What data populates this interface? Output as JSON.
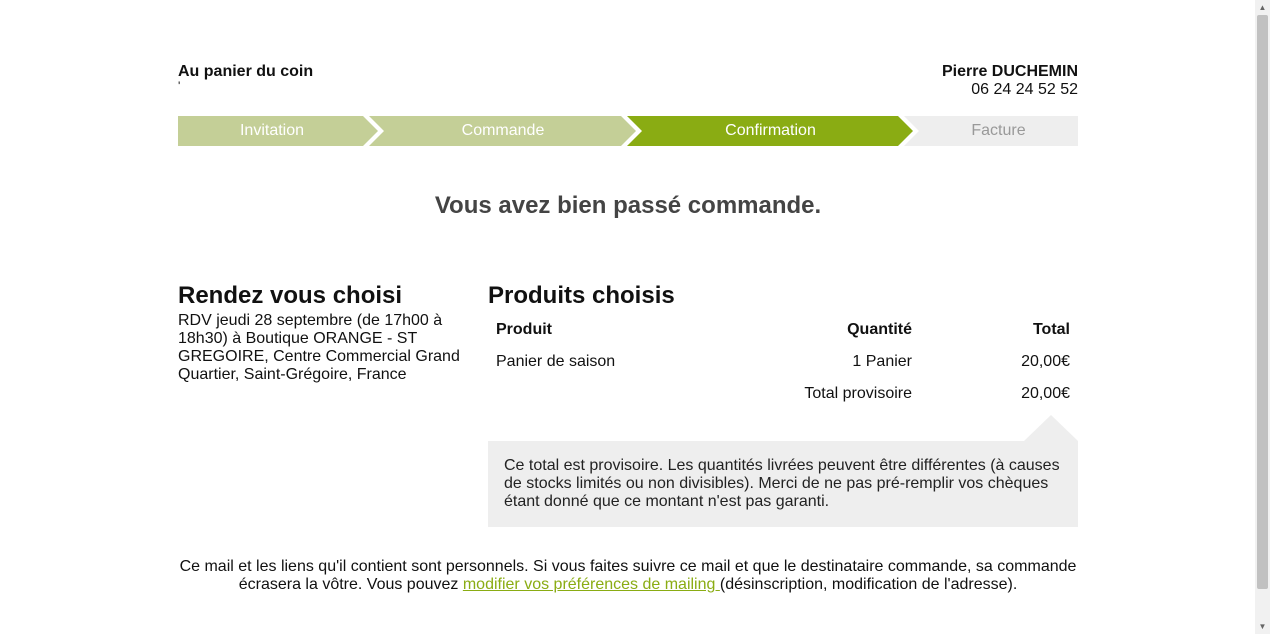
{
  "header": {
    "shop_name": "Au panier du coin",
    "shop_sub": "'",
    "user_name": "Pierre DUCHEMIN",
    "user_phone": "06 24 24 52 52"
  },
  "steps": [
    {
      "label": "Invitation",
      "state": "done"
    },
    {
      "label": "Commande",
      "state": "done"
    },
    {
      "label": "Confirmation",
      "state": "active"
    },
    {
      "label": "Facture",
      "state": "pending"
    }
  ],
  "colors": {
    "step_done": "#c4cf97",
    "step_active": "#8aac13",
    "step_pending": "#eeeeee",
    "link": "#8aac13"
  },
  "confirm_title": "Vous avez bien passé commande.",
  "rdv": {
    "heading": "Rendez vous choisi",
    "text": "RDV jeudi 28 septembre (de 17h00 à 18h30) à Boutique ORANGE - ST GREGOIRE, Centre Commercial Grand Quartier, Saint-Grégoire, France"
  },
  "products": {
    "heading": "Produits choisis",
    "columns": [
      "Produit",
      "Quantité",
      "Total"
    ],
    "rows": [
      {
        "product": "Panier de saison",
        "quantity": "1 Panier",
        "total": "20,00€"
      }
    ],
    "subtotal_label": "Total provisoire",
    "subtotal_value": "20,00€"
  },
  "notice": "Ce total est provisoire. Les quantités livrées peuvent être différentes (à causes de stocks limités ou non divisibles). Merci de ne pas pré-remplir vos chèques étant donné que ce montant n'est pas garanti.",
  "footer": {
    "text_before": "Ce mail et les liens qu'il contient sont personnels. Si vous faites suivre ce mail et que le destinataire commande, sa commande écrasera la vôtre. Vous pouvez ",
    "link_text": "modifier vos préférences de mailing ",
    "text_after": "(désinscription, modification de l'adresse)."
  },
  "scrollbar": {
    "up_icon": "triangle-up",
    "down_icon": "triangle-down"
  }
}
